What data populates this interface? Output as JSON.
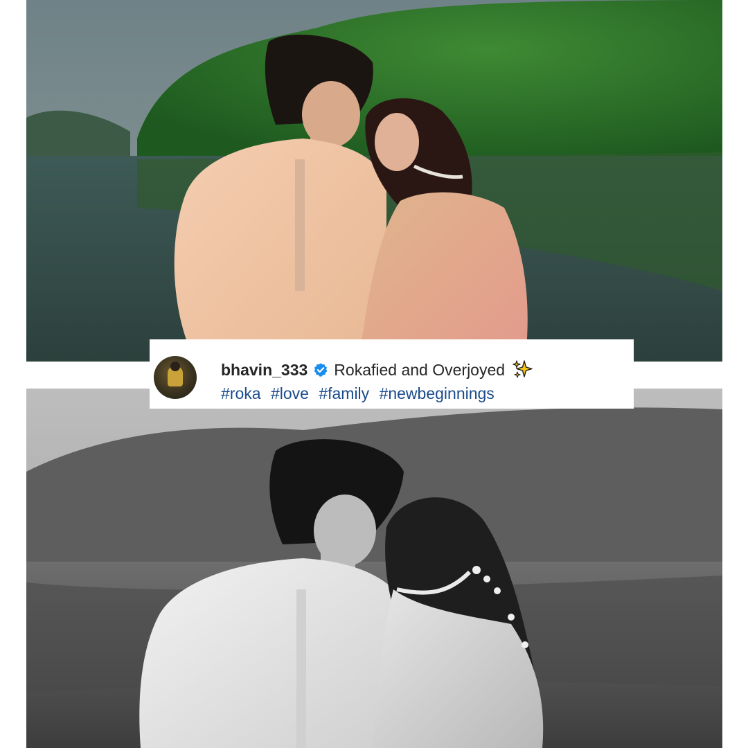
{
  "post": {
    "username": "bhavin_333",
    "caption": "Rokafied and Overjoyed",
    "hashtags": [
      "#roka",
      "#love",
      "#family",
      "#newbeginnings"
    ]
  },
  "icons": {
    "verified": "verified-badge-icon",
    "sparkle": "sparkles-emoji-icon"
  },
  "colors": {
    "hashtag": "#1a4b8c",
    "verified": "#1a8cf0",
    "text": "#262626"
  }
}
